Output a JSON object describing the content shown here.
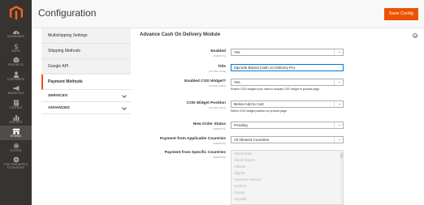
{
  "colors": {
    "nav_bg": "#373330",
    "accent": "#eb5202",
    "header_bg": "#f8f8f8"
  },
  "nav": {
    "logo_icon": "magento-logo",
    "items": [
      {
        "label": "Dashboard",
        "icon": "dashboard-icon"
      },
      {
        "label": "Sales",
        "icon": "dollar-icon"
      },
      {
        "label": "Products",
        "icon": "cube-icon"
      },
      {
        "label": "Customers",
        "icon": "person-icon"
      },
      {
        "label": "Marketing",
        "icon": "megaphone-icon"
      },
      {
        "label": "Content",
        "icon": "content-icon"
      },
      {
        "label": "Reports",
        "icon": "bar-chart-icon"
      },
      {
        "label": "Stores",
        "icon": "store-icon"
      },
      {
        "label": "System",
        "icon": "gear-icon"
      },
      {
        "label": "Find Partners & Extensions",
        "icon": "extensions-icon"
      }
    ],
    "active_index": 7
  },
  "header": {
    "title": "Configuration",
    "save_label": "Save Config"
  },
  "tabs": {
    "links": [
      "Multishipping Settings",
      "Shipping Methods",
      "Google API",
      "Payment Methods"
    ],
    "active": "Payment Methods",
    "sections": [
      "SERVICES",
      "ADVANCED"
    ]
  },
  "section": {
    "title": "Advance Cash On Delivery Module",
    "fields": {
      "enabled": {
        "label": "Enabled",
        "scope": "[WEBSITE]",
        "value": "Yes"
      },
      "title": {
        "label": "Title",
        "scope": "[STORE VIEW]",
        "value": "Zipcode Based Cash on Delivery Pro"
      },
      "cod_widget": {
        "label": "Enabled COD Widget?",
        "scope": "[STORE VIEW]",
        "value": "Yes",
        "note": "Enable COD widget if you want to display COD widget in product page"
      },
      "widget_position": {
        "label": "COD Widget Position",
        "scope": "[STORE VIEW]",
        "value": "Below Add to Cart",
        "note": "Select COD widget position on product page"
      },
      "order_status": {
        "label": "New Order Status",
        "scope": "[WEBSITE]",
        "value": "Pending"
      },
      "applicable_countries": {
        "label": "Payment from Applicable Countries",
        "scope": "[WEBSITE]",
        "value": "All Allowed Countries"
      },
      "specific_countries": {
        "label": "Payment from Specific Countries",
        "scope": "[WEBSITE]",
        "options": [
          "Afghanistan",
          "Åland Islands",
          "Albania",
          "Algeria",
          "American Samoa",
          "Andorra",
          "Angola",
          "Anguilla"
        ]
      }
    }
  }
}
